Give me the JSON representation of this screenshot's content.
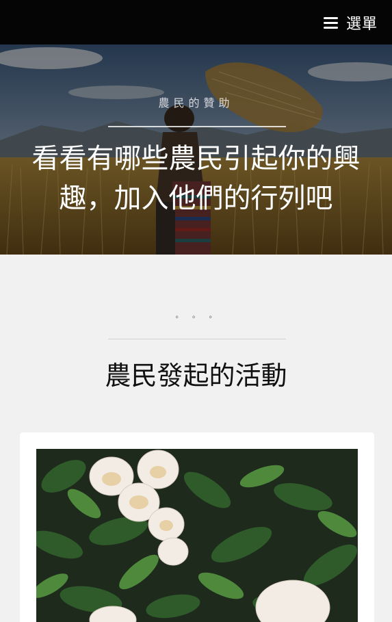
{
  "header": {
    "menu_icon": "hamburger-icon",
    "menu_label": "選單"
  },
  "hero": {
    "kicker": "農民的贊助",
    "title": "看看有哪些農民引起你的興趣，加入他們的行列吧"
  },
  "section": {
    "dots": "。。。",
    "title": "農民發起的活動"
  },
  "colors": {
    "topbar": "#050505",
    "page_background": "#f1f1f1",
    "card_background": "#ffffff"
  }
}
